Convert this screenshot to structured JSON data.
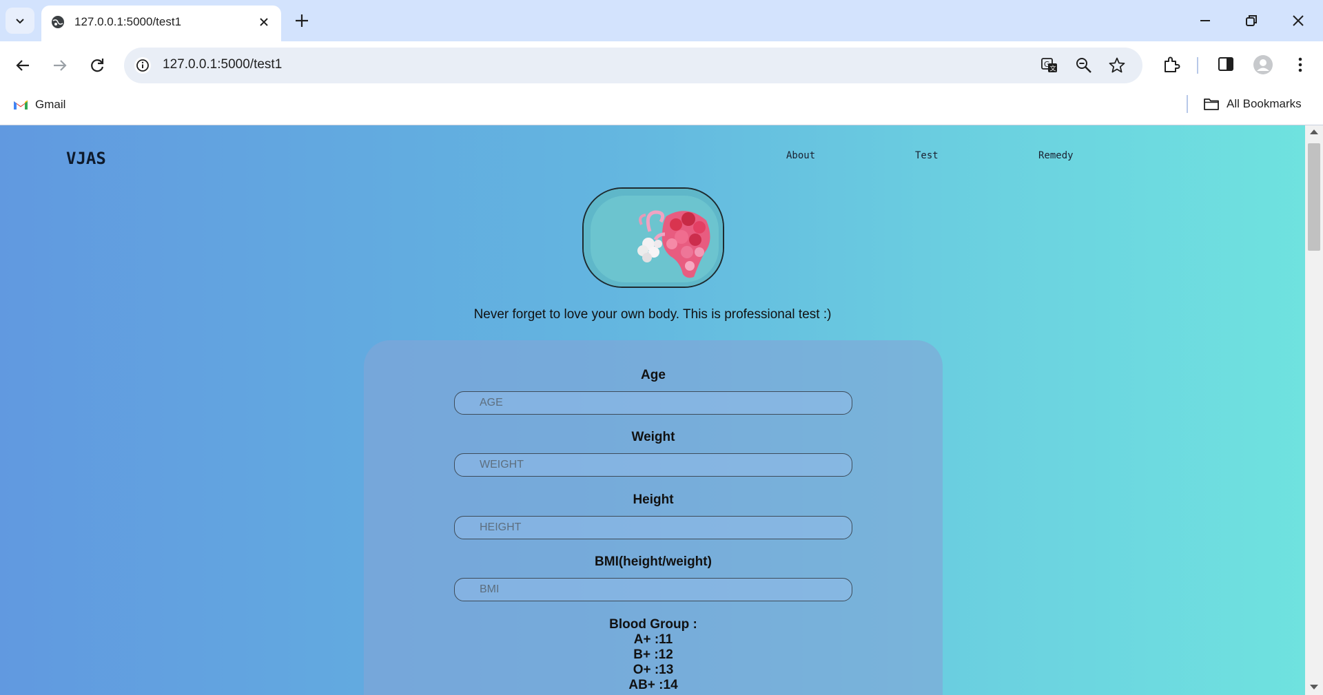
{
  "browser": {
    "tab_title": "127.0.0.1:5000/test1",
    "url": "127.0.0.1:5000/test1",
    "bookmarks": {
      "gmail_label": "Gmail",
      "all_bookmarks_label": "All Bookmarks"
    },
    "icons": [
      "tab-search-icon",
      "globe-icon",
      "close-icon",
      "plus-icon",
      "minimize-icon",
      "restore-icon",
      "window-close-icon",
      "back-icon",
      "forward-icon",
      "reload-icon",
      "site-info-icon",
      "translate-icon",
      "zoom-icon",
      "star-icon",
      "extensions-icon",
      "side-panel-icon",
      "profile-icon",
      "menu-icon",
      "gmail-icon",
      "folder-icon"
    ]
  },
  "page": {
    "brand": "VJAS",
    "nav": [
      {
        "label": "About"
      },
      {
        "label": "Test"
      },
      {
        "label": "Remedy"
      }
    ],
    "tagline": "Never forget to love your own body. This is professional test :)",
    "form": {
      "fields": [
        {
          "label": "Age",
          "placeholder": "AGE",
          "value": ""
        },
        {
          "label": "Weight",
          "placeholder": "WEIGHT",
          "value": ""
        },
        {
          "label": "Height",
          "placeholder": "HEIGHT",
          "value": ""
        },
        {
          "label": "BMI(height/weight)",
          "placeholder": "BMI",
          "value": ""
        }
      ],
      "blood_group": {
        "title": "Blood Group :",
        "lines": [
          "A+ :11",
          "B+ :12",
          "O+ :13",
          "AB+ :14"
        ]
      }
    }
  },
  "colors": {
    "page_gradient_start": "#6199e0",
    "page_gradient_end": "#6fe3df",
    "tabstrip": "#d3e3fd"
  }
}
